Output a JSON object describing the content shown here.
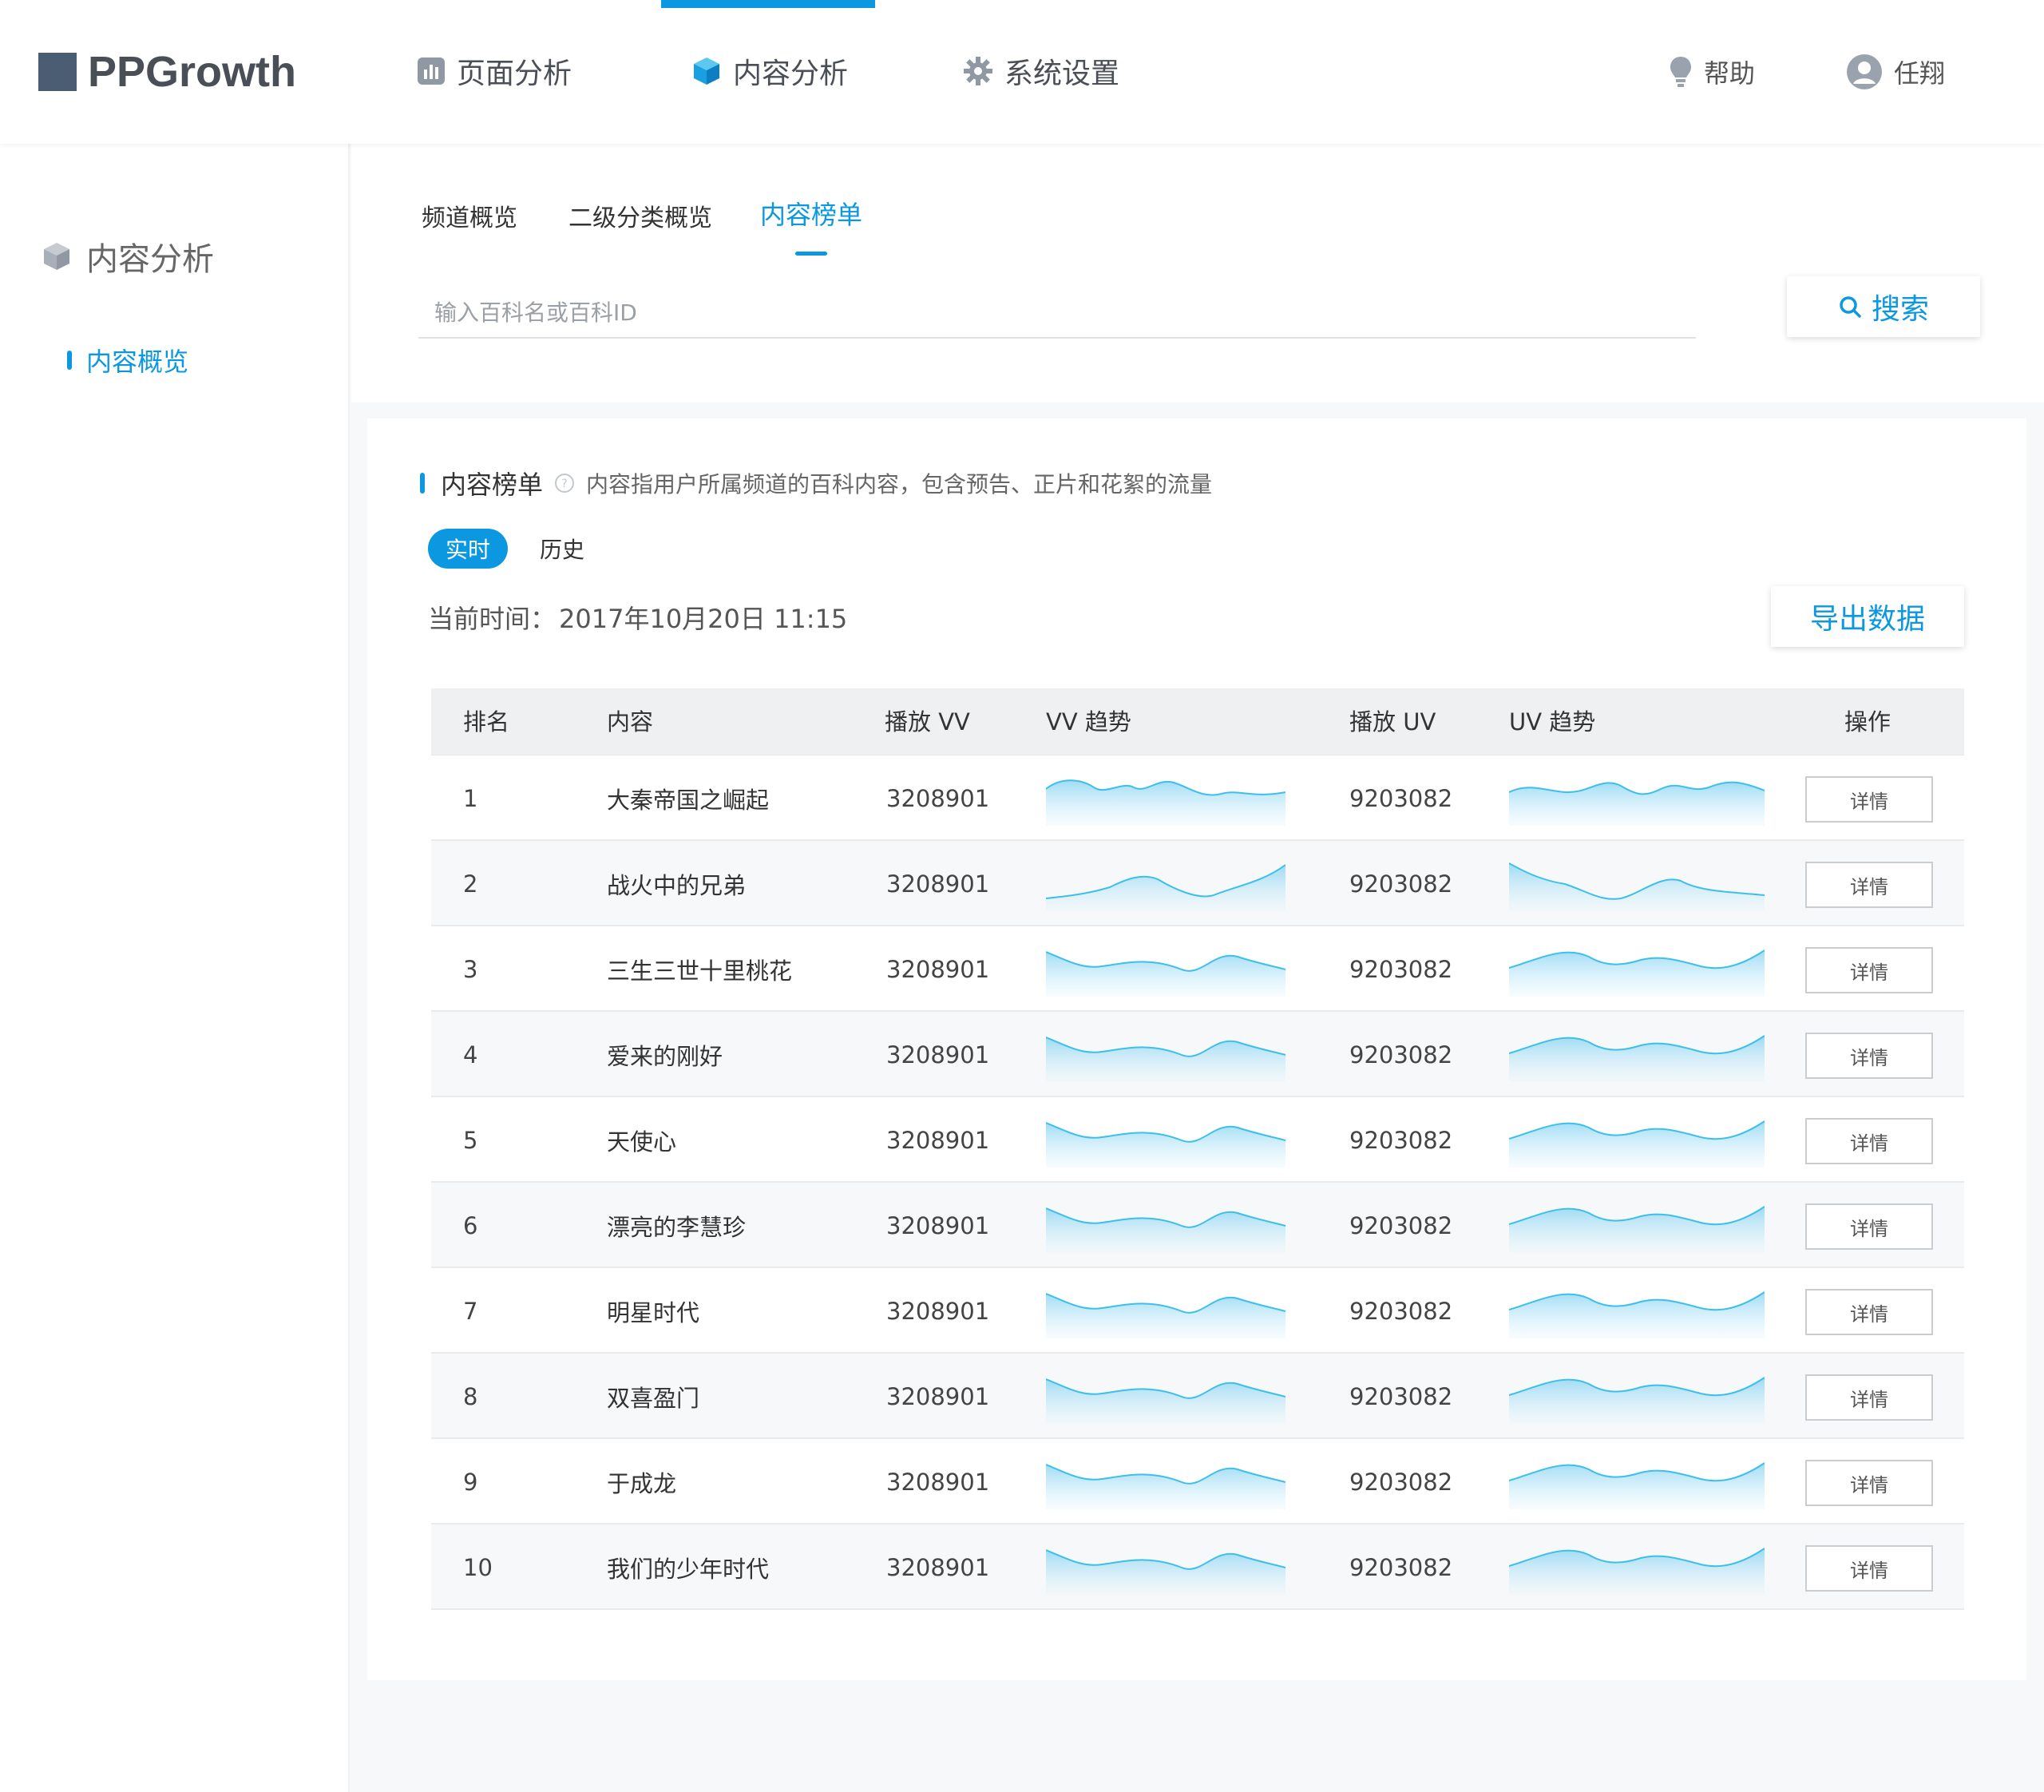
{
  "app": {
    "logo_text": "PPGrowth"
  },
  "nav": {
    "items": [
      {
        "label": "页面分析",
        "icon": "bar-chart-icon"
      },
      {
        "label": "内容分析",
        "icon": "cube-icon"
      },
      {
        "label": "系统设置",
        "icon": "gear-icon"
      }
    ],
    "active_index": 1
  },
  "utility": {
    "help": "帮助",
    "user": "任翔"
  },
  "sidebar": {
    "section_title": "内容分析",
    "items": [
      {
        "label": "内容概览",
        "active": true
      }
    ]
  },
  "subtabs": [
    {
      "label": "频道概览"
    },
    {
      "label": "二级分类概览"
    },
    {
      "label": "内容榜单",
      "active": true
    }
  ],
  "search": {
    "placeholder": "输入百科名或百科ID",
    "button_label": "搜索"
  },
  "card": {
    "title": "内容榜单",
    "description": "内容指用户所属频道的百科内容，包含预告、正片和花絮的流量",
    "toggle_active": "实时",
    "toggle_other": "历史",
    "time_label": "当前时间：",
    "time_value": "2017年10月20日 11:15",
    "export_label": "导出数据"
  },
  "table": {
    "headers": [
      "排名",
      "内容",
      "播放 VV",
      "VV 趋势",
      "播放 UV",
      "UV 趋势",
      "操作"
    ],
    "detail_label": "详情",
    "rows": [
      {
        "rank": "1",
        "content": "大秦帝国之崛起",
        "vv": "3208901",
        "uv": "9203082"
      },
      {
        "rank": "2",
        "content": "战火中的兄弟",
        "vv": "3208901",
        "uv": "9203082"
      },
      {
        "rank": "3",
        "content": "三生三世十里桃花",
        "vv": "3208901",
        "uv": "9203082"
      },
      {
        "rank": "4",
        "content": "爱来的刚好",
        "vv": "3208901",
        "uv": "9203082"
      },
      {
        "rank": "5",
        "content": "天使心",
        "vv": "3208901",
        "uv": "9203082"
      },
      {
        "rank": "6",
        "content": "漂亮的李慧珍",
        "vv": "3208901",
        "uv": "9203082"
      },
      {
        "rank": "7",
        "content": "明星时代",
        "vv": "3208901",
        "uv": "9203082"
      },
      {
        "rank": "8",
        "content": "双喜盈门",
        "vv": "3208901",
        "uv": "9203082"
      },
      {
        "rank": "9",
        "content": "于成龙",
        "vv": "3208901",
        "uv": "9203082"
      },
      {
        "rank": "10",
        "content": "我们的少年时代",
        "vv": "3208901",
        "uv": "9203082"
      }
    ]
  },
  "colors": {
    "accent": "#0b98e0",
    "sparkline": "#3cc0ea"
  }
}
